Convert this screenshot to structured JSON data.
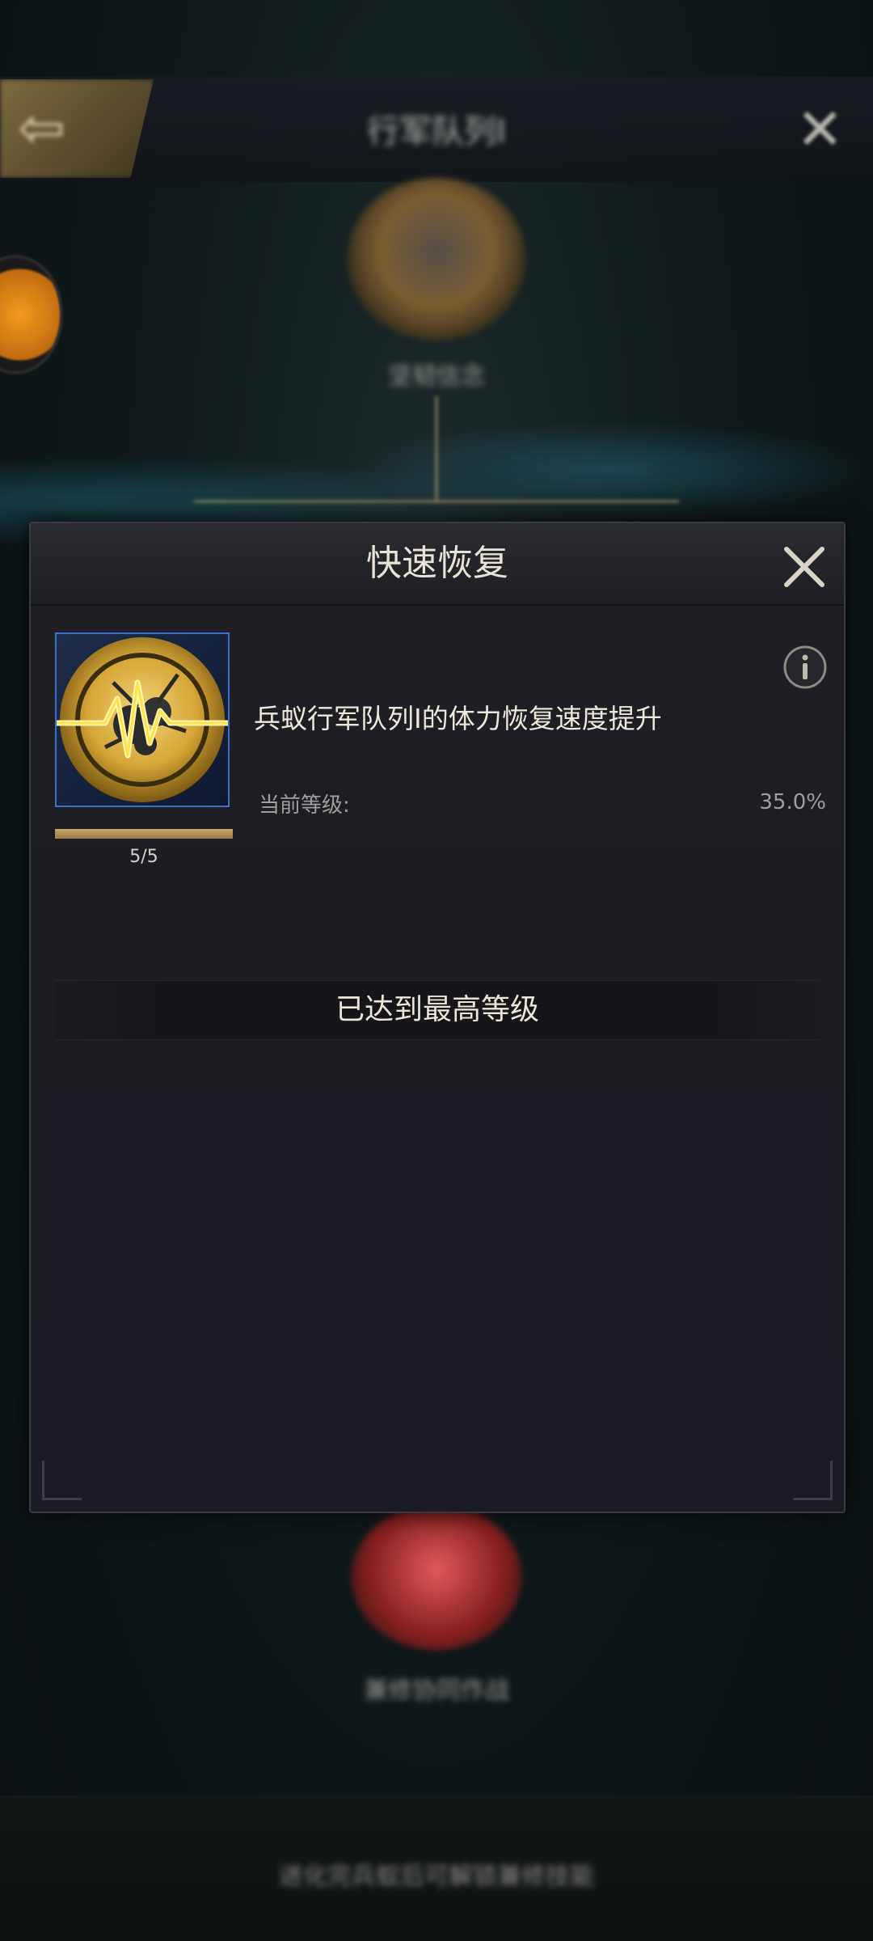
{
  "background": {
    "title": "行军队列I",
    "top_node_label": "坚韧信念",
    "bottom_node_label": "兼修协同作战",
    "footer_text": "进化完兵蚁后可解锁兼修技能"
  },
  "modal": {
    "title": "快速恢复",
    "skill": {
      "icon": "ant-heartbeat-icon",
      "level_text": "5/5",
      "level_current": 5,
      "level_max": 5,
      "description": "兵蚁行军队列I的体力恢复速度提升",
      "current_level_label": "当前等级:",
      "current_level_value": "35.0%"
    },
    "max_level_text": "已达到最高等级"
  },
  "colors": {
    "accent_gold": "#c9a56a",
    "frame_blue": "#3f6fc4"
  }
}
